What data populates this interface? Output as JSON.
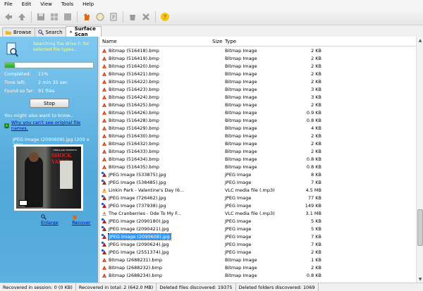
{
  "menu": [
    "File",
    "Edit",
    "View",
    "Tools",
    "Help"
  ],
  "tabs": [
    {
      "label": "Browse",
      "icon": "folder-icon"
    },
    {
      "label": "Search",
      "icon": "magnifier-icon"
    },
    {
      "label": "Surface Scan",
      "icon": "scan-icon"
    }
  ],
  "scan": {
    "message": "Searching the drive F: for selected file types...",
    "progress_percent": 11,
    "completed_label": "Completed:",
    "completed_value": "11%",
    "timeleft_label": "Time left:",
    "timeleft_value": "2 min 35 sec",
    "found_label": "Found so far:",
    "found_value": "91 files",
    "stop_label": "Stop",
    "also_text": "You might also want to know...",
    "why_link": "Why you can't see original file names."
  },
  "preview": {
    "title": "JPEG Image (2090608).jpg (200 x 200)",
    "album_title": "SHOCK VALUE",
    "album_artist": "TIMBALAND PRESENTS",
    "enlarge_label": "Enlarge",
    "recover_label": "Recover"
  },
  "filelist": {
    "columns": {
      "name": "Name",
      "size": "Size",
      "type": "Type"
    },
    "rows": [
      {
        "icon": "bitmap-icon",
        "name": "Bitmap (516418).bmp",
        "size": "2 KB",
        "type": "Bitmap Image"
      },
      {
        "icon": "bitmap-icon",
        "name": "Bitmap (516419).bmp",
        "size": "2 KB",
        "type": "Bitmap Image"
      },
      {
        "icon": "bitmap-icon",
        "name": "Bitmap (516420).bmp",
        "size": "2 KB",
        "type": "Bitmap Image"
      },
      {
        "icon": "bitmap-icon",
        "name": "Bitmap (516421).bmp",
        "size": "2 KB",
        "type": "Bitmap Image"
      },
      {
        "icon": "bitmap-icon",
        "name": "Bitmap (516422).bmp",
        "size": "2 KB",
        "type": "Bitmap Image"
      },
      {
        "icon": "bitmap-icon",
        "name": "Bitmap (516423).bmp",
        "size": "3 KB",
        "type": "Bitmap Image"
      },
      {
        "icon": "bitmap-icon",
        "name": "Bitmap (516424).bmp",
        "size": "3 KB",
        "type": "Bitmap Image"
      },
      {
        "icon": "bitmap-icon",
        "name": "Bitmap (516425).bmp",
        "size": "2 KB",
        "type": "Bitmap Image"
      },
      {
        "icon": "bitmap-icon",
        "name": "Bitmap (516426).bmp",
        "size": "0.9 KB",
        "type": "Bitmap Image"
      },
      {
        "icon": "bitmap-icon",
        "name": "Bitmap (516428).bmp",
        "size": "0.8 KB",
        "type": "Bitmap Image"
      },
      {
        "icon": "bitmap-icon",
        "name": "Bitmap (516429).bmp",
        "size": "4 KB",
        "type": "Bitmap Image"
      },
      {
        "icon": "bitmap-icon",
        "name": "Bitmap (516430).bmp",
        "size": "2 KB",
        "type": "Bitmap Image"
      },
      {
        "icon": "bitmap-icon",
        "name": "Bitmap (516432).bmp",
        "size": "2 KB",
        "type": "Bitmap Image"
      },
      {
        "icon": "bitmap-icon",
        "name": "Bitmap (516433).bmp",
        "size": "2 KB",
        "type": "Bitmap Image"
      },
      {
        "icon": "bitmap-icon",
        "name": "Bitmap (516434).bmp",
        "size": "0.8 KB",
        "type": "Bitmap Image"
      },
      {
        "icon": "bitmap-icon",
        "name": "Bitmap (516435).bmp",
        "size": "0.8 KB",
        "type": "Bitmap Image"
      },
      {
        "icon": "jpeg-icon",
        "name": "JPEG Image (533875).jpg",
        "size": "8 KB",
        "type": "JPEG Image"
      },
      {
        "icon": "jpeg-icon",
        "name": "JPEG Image (538485).jpg",
        "size": "7 KB",
        "type": "JPEG Image"
      },
      {
        "icon": "vlc-icon",
        "name": "Linkin Park - Valentine's Day (6...",
        "size": "4.5 MB",
        "type": "VLC media file (.mp3)"
      },
      {
        "icon": "jpeg-icon",
        "name": "JPEG Image (726462).jpg",
        "size": "77 KB",
        "type": "JPEG Image"
      },
      {
        "icon": "jpeg-icon",
        "name": "JPEG Image (737938).jpg",
        "size": "149 KB",
        "type": "JPEG Image"
      },
      {
        "icon": "vlc-icon",
        "name": "The Cranberries - Ode To My F...",
        "size": "3.1 MB",
        "type": "VLC media file (.mp3)"
      },
      {
        "icon": "jpeg-icon",
        "name": "JPEG Image (2090180).jpg",
        "size": "5 KB",
        "type": "JPEG Image"
      },
      {
        "icon": "jpeg-icon",
        "name": "JPEG Image (2090421).jpg",
        "size": "5 KB",
        "type": "JPEG Image"
      },
      {
        "icon": "jpeg-icon",
        "name": "JPEG Image (2090608).jpg",
        "size": "7 KB",
        "type": "JPEG Image",
        "selected": true
      },
      {
        "icon": "jpeg-icon",
        "name": "JPEG Image (2090624).jpg",
        "size": "7 KB",
        "type": "JPEG Image"
      },
      {
        "icon": "jpeg-icon",
        "name": "JPEG Image (2551374).jpg",
        "size": "2 KB",
        "type": "JPEG Image"
      },
      {
        "icon": "bitmap-icon",
        "name": "Bitmap (2688231).bmp",
        "size": "1 KB",
        "type": "Bitmap Image"
      },
      {
        "icon": "bitmap-icon",
        "name": "Bitmap (2688232).bmp",
        "size": "2 KB",
        "type": "Bitmap Image"
      },
      {
        "icon": "bitmap-icon",
        "name": "Bitmap (2688234).bmp",
        "size": "0.8 KB",
        "type": "Bitmap Image"
      }
    ]
  },
  "status": {
    "session": "Recovered in session: 0 (0 KB)",
    "total": "Recovered in total: 2 (642.0 MB)",
    "deleted_files": "Deleted files discovered: 19375",
    "deleted_folders": "Deleted folders discovered: 1069"
  },
  "colors": {
    "panel_blue": "#4fa8d9",
    "scan_text": "#ffff80",
    "selection": "#3399ff"
  }
}
